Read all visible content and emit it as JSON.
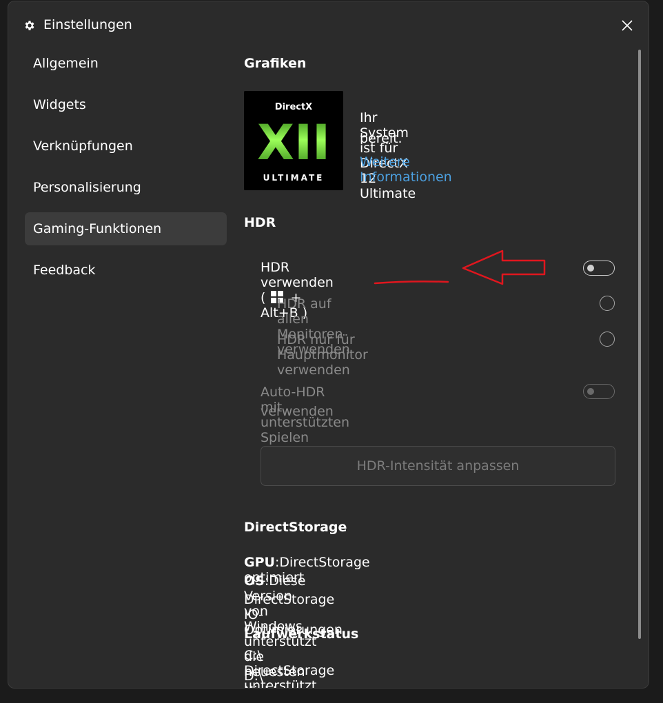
{
  "window": {
    "title": "Einstellungen",
    "icons": {
      "title": "gear-icon",
      "close": "close-icon"
    }
  },
  "sidebar": {
    "items": [
      {
        "label": "Allgemein",
        "active": false
      },
      {
        "label": "Widgets",
        "active": false
      },
      {
        "label": "Verknüpfungen",
        "active": false
      },
      {
        "label": "Personalisierung",
        "active": false
      },
      {
        "label": "Gaming-Funktionen",
        "active": true
      },
      {
        "label": "Feedback",
        "active": false
      }
    ]
  },
  "graphics": {
    "heading": "Grafiken",
    "logo": {
      "top": "DirectX",
      "big": "XII",
      "bottom": "ULTIMATE"
    },
    "status_line1": "Ihr System ist für DirectX 12 Ultimate",
    "status_line2": "bereit.",
    "more_info": "Weitere Informationen"
  },
  "hdr": {
    "heading": "HDR",
    "use_prefix": "HDR verwenden (",
    "use_shortcut": "+ Alt+B )",
    "use_toggle": "off",
    "all_monitors": "HDR auf allen Monitoren verwenden",
    "main_monitor": "HDR nur für Hauptmonitor verwenden",
    "auto_line1": "Auto-HDR mit unterstützten Spielen",
    "auto_line2": "verwenden",
    "auto_toggle": "off",
    "intensity_button": "HDR-Intensität anpassen",
    "shortcut_icon": "windows-icon",
    "annotation": "red-arrow-icon"
  },
  "directstorage": {
    "heading": "DirectStorage",
    "gpu_label": "GPU",
    "gpu_value": ":DirectStorage optimiert",
    "os_label": "OS",
    "os_value": ":Diese Version von Windows unterstützt die neuesten",
    "os_value2": "DirectStorage IO-Optimierungen"
  },
  "drives": {
    "heading": "Laufwerkstatus",
    "c": "C:\\ DirectStorage unterstützt",
    "d": "D:\\ Nicht-NVMe-Laufwerk"
  },
  "colors": {
    "accent_link": "#4ca0e0",
    "annotation_red": "#e0161e",
    "logo_green": "#5de01a"
  }
}
